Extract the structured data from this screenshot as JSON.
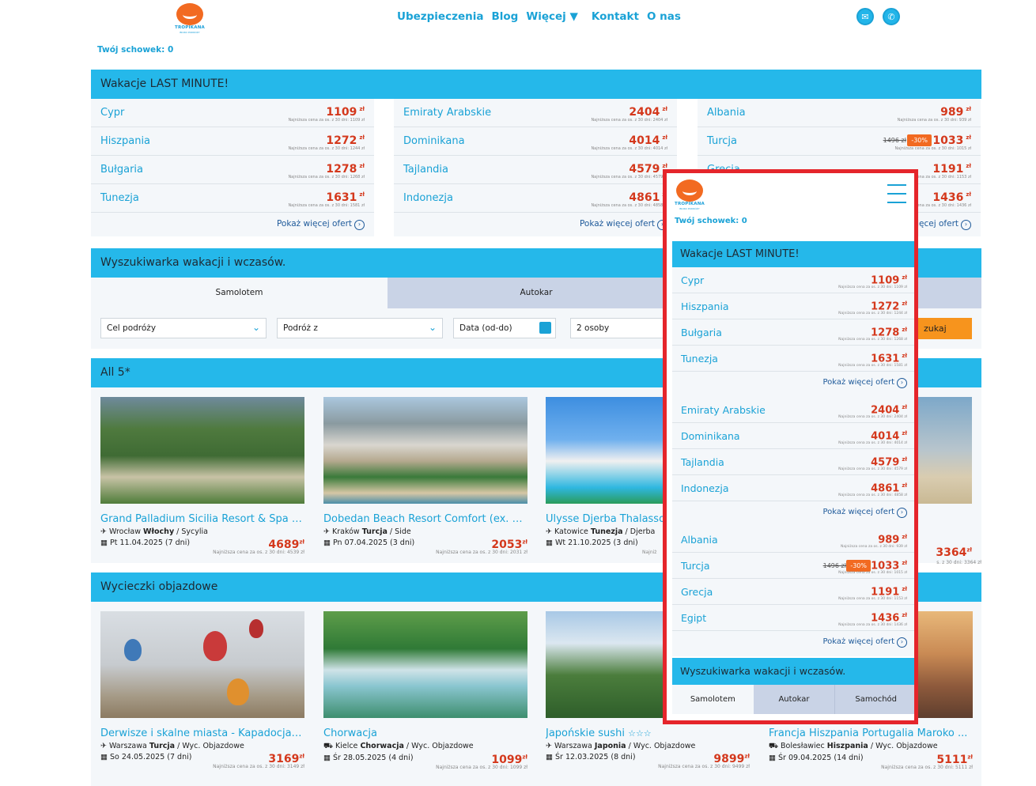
{
  "logo": {
    "word": "TROPIKANA",
    "sub": "BIURO PODRÓŻY"
  },
  "nav": [
    "Ubezpieczenia",
    "Blog",
    "Więcej ▼",
    "Kontakt",
    "O nas"
  ],
  "schowek": "Twój schowek: 0",
  "lastminute": {
    "title": "Wakacje LAST MINUTE!",
    "currency": "zł",
    "more": "Pokaż więcej ofert",
    "columns": [
      [
        {
          "dest": "Cypr",
          "price": "1109",
          "note": "Najniższa cena za os. z 30 dni: 1109 zł"
        },
        {
          "dest": "Hiszpania",
          "price": "1272",
          "note": "Najniższa cena za os. z 30 dni: 1244 zł"
        },
        {
          "dest": "Bułgaria",
          "price": "1278",
          "note": "Najniższa cena za os. z 30 dni: 1268 zł"
        },
        {
          "dest": "Tunezja",
          "price": "1631",
          "note": "Najniższa cena za os. z 30 dni: 1581 zł"
        }
      ],
      [
        {
          "dest": "Emiraty Arabskie",
          "price": "2404",
          "note": "Najniższa cena za os. z 30 dni: 2404 zł"
        },
        {
          "dest": "Dominikana",
          "price": "4014",
          "note": "Najniższa cena za os. z 30 dni: 4014 zł"
        },
        {
          "dest": "Tajlandia",
          "price": "4579",
          "note": "Najniższa cena za os. z 30 dni: 4579 zł"
        },
        {
          "dest": "Indonezja",
          "price": "4861",
          "note": "Najniższa cena za os. z 30 dni: 4858 zł"
        }
      ],
      [
        {
          "dest": "Albania",
          "price": "989",
          "note": "Najniższa cena za os. z 30 dni: 939 zł"
        },
        {
          "dest": "Turcja",
          "price": "1033",
          "old": "1496 zł",
          "disc": "-30%",
          "note": "Najniższa cena za os. z 30 dni: 1015 zł"
        },
        {
          "dest": "Grecja",
          "price": "1191",
          "note": "Najniższa cena za os. z 30 dni: 1153 zł"
        },
        {
          "dest": "Egipt",
          "price": "1436",
          "note": "Najniższa cena za os. z 30 dni: 1436 zł"
        }
      ]
    ]
  },
  "search": {
    "title": "Wyszukiwarka wakacji i wczasów.",
    "tabs": [
      "Samolotem",
      "Autokar",
      "Samochód"
    ],
    "dest": "Cel podróży",
    "from": "Podróż z",
    "date": "Data (od-do)",
    "persons": "2 osoby",
    "submit": "Szukaj",
    "submit_visible": "zukaj"
  },
  "all5": {
    "title": "All 5*",
    "cards": [
      {
        "title": "Grand Palladium Sicilia Resort & Spa (...",
        "from": "Wrocław",
        "country": "Włochy",
        "region": "Sycylia",
        "date": "Pt 11.04.2025 (7 dni)",
        "price": "4689",
        "note": "Najniższa cena za os. z 30 dni: 4539 zł"
      },
      {
        "title": "Dobedan Beach Resort Comfort (ex. Al...",
        "from": "Kraków",
        "country": "Turcja",
        "region": "Side",
        "date": "Pn 07.04.2025 (3 dni)",
        "price": "2053",
        "note": "Najniższa cena za os. z 30 dni: 2031 zł"
      },
      {
        "title": "Ulysse Djerba Thalasso",
        "from": "Katowice",
        "country": "Tunezja",
        "region": "Djerba",
        "date": "Wt 21.10.2025 (3 dni)",
        "price": "",
        "note": "Najniż"
      },
      {
        "title": "",
        "from": "",
        "country": "",
        "region": "",
        "date": "",
        "price": "3364",
        "note": "s. z 30 dni: 3364 zł"
      }
    ]
  },
  "tours": {
    "title": "Wycieczki objazdowe",
    "cards": [
      {
        "title": "Derwisze i skalne miasta - Kapadocja ...",
        "from": "Warszawa",
        "country": "Turcja",
        "region": "Wyc. Objazdowe",
        "date": "So 24.05.2025 (7 dni)",
        "price": "3169",
        "note": "Najniższa cena za os. z 30 dni: 3149 zł"
      },
      {
        "title": "Chorwacja",
        "from": "Kielce",
        "country": "Chorwacja",
        "region": "Wyc. Objazdowe",
        "date": "Śr 28.05.2025 (4 dni)",
        "price": "1099",
        "note": "Najniższa cena za os. z 30 dni: 1099 zł"
      },
      {
        "title": "Japońskie sushi",
        "stars": "☆☆☆",
        "from": "Warszawa",
        "country": "Japonia",
        "region": "Wyc. Objazdowe",
        "date": "Śr 12.03.2025 (8 dni)",
        "price": "9899",
        "note": "Najniższa cena za os. z 30 dni: 9499 zł"
      },
      {
        "title": "Francja Hiszpania Portugalia Maroko ...",
        "from": "Bolesławiec",
        "country": "Hiszpania",
        "region": "Wyc. Objazdowe",
        "date": "Śr 09.04.2025 (14 dni)",
        "price": "5111",
        "note": "Najniższa cena za os. z 30 dni: 5111 zł"
      }
    ]
  },
  "colors": {
    "brand": "#25b8ea",
    "price": "#d4381c",
    "discount": "#f26a21",
    "highlight": "#e5252b"
  }
}
